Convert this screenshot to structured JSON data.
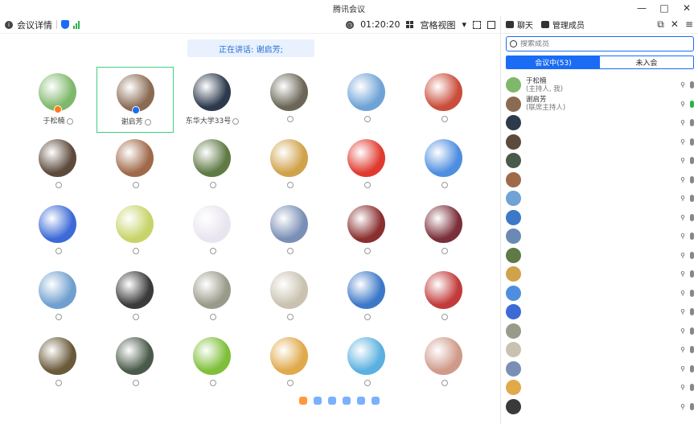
{
  "window": {
    "title": "腾讯会议",
    "controls": [
      "—",
      "□",
      "✕"
    ]
  },
  "toolbar": {
    "meeting_details": "会议详情",
    "timer": "01:20:20",
    "view_mode": "宫格视图"
  },
  "speaker_banner": "正在讲话: 谢启芳;",
  "grid": {
    "tiles": [
      {
        "name": "于松楠",
        "color": "#7fb86b",
        "badge": "orange"
      },
      {
        "name": "谢启芳",
        "color": "#8a6b52",
        "badge": "blue",
        "active": true
      },
      {
        "name": "东华大学33号",
        "color": "#2d3a4d",
        "badge": ""
      },
      {
        "name": "",
        "color": "#6b6657",
        "badge": ""
      },
      {
        "name": "",
        "color": "#6fa3d6",
        "badge": ""
      },
      {
        "name": "",
        "color": "#c94d3a",
        "badge": ""
      },
      {
        "name": "",
        "color": "#5c4a3c",
        "badge": ""
      },
      {
        "name": "",
        "color": "#a06a4a",
        "badge": ""
      },
      {
        "name": "",
        "color": "#5f7a44",
        "badge": ""
      },
      {
        "name": "",
        "color": "#d0a24a",
        "badge": ""
      },
      {
        "name": "",
        "color": "#e03a2f",
        "badge": ""
      },
      {
        "name": "",
        "color": "#4e8ee0",
        "badge": ""
      },
      {
        "name": "",
        "color": "#3c6ad6",
        "badge": ""
      },
      {
        "name": "",
        "color": "#c8d46a",
        "badge": ""
      },
      {
        "name": "",
        "color": "#e9e5f0",
        "badge": ""
      },
      {
        "name": "",
        "color": "#7a8fb5",
        "badge": ""
      },
      {
        "name": "",
        "color": "#8a2f2f",
        "badge": ""
      },
      {
        "name": "",
        "color": "#7a2f3a",
        "badge": ""
      },
      {
        "name": "",
        "color": "#6f9fcf",
        "badge": ""
      },
      {
        "name": "",
        "color": "#3a3a3a",
        "badge": ""
      },
      {
        "name": "",
        "color": "#9a9a8a",
        "badge": ""
      },
      {
        "name": "",
        "color": "#c9c2b0",
        "badge": ""
      },
      {
        "name": "",
        "color": "#3c78c8",
        "badge": ""
      },
      {
        "name": "",
        "color": "#c23a3a",
        "badge": ""
      },
      {
        "name": "",
        "color": "#6a5a3a",
        "badge": ""
      },
      {
        "name": "",
        "color": "#4a5a4a",
        "badge": ""
      },
      {
        "name": "",
        "color": "#7fbf3a",
        "badge": ""
      },
      {
        "name": "",
        "color": "#e0a94a",
        "badge": ""
      },
      {
        "name": "",
        "color": "#5ab0e0",
        "badge": ""
      },
      {
        "name": "",
        "color": "#d09a8a",
        "badge": ""
      }
    ]
  },
  "panel": {
    "tab_chat": "聊天",
    "tab_members": "管理成员",
    "search_placeholder": "搜索成员",
    "seg_in_meeting": "会议中(53)",
    "seg_not_joined": "未入会",
    "members": [
      {
        "name": "于松楠",
        "sub": "(主持人, 我)",
        "color": "#7fb86b",
        "mic": "gray"
      },
      {
        "name": "谢启芳",
        "sub": "(联席主持人)",
        "color": "#8a6b52",
        "mic": "green"
      },
      {
        "name": "",
        "sub": "",
        "color": "#2d3a4d",
        "mic": "gray"
      },
      {
        "name": "",
        "sub": "",
        "color": "#5c4a3c",
        "mic": "gray"
      },
      {
        "name": "",
        "sub": "",
        "color": "#4a5a4a",
        "mic": "gray"
      },
      {
        "name": "",
        "sub": "",
        "color": "#a06a4a",
        "mic": "gray"
      },
      {
        "name": "",
        "sub": "",
        "color": "#6fa3d6",
        "mic": "gray"
      },
      {
        "name": "",
        "sub": "",
        "color": "#3c78c8",
        "mic": "gray"
      },
      {
        "name": "",
        "sub": "",
        "color": "#6a8ab5",
        "mic": "gray"
      },
      {
        "name": "",
        "sub": "",
        "color": "#5f7a44",
        "mic": "gray"
      },
      {
        "name": "",
        "sub": "",
        "color": "#d0a24a",
        "mic": "gray"
      },
      {
        "name": "",
        "sub": "",
        "color": "#4e8ee0",
        "mic": "gray"
      },
      {
        "name": "",
        "sub": "",
        "color": "#3c6ad6",
        "mic": "gray"
      },
      {
        "name": "",
        "sub": "",
        "color": "#9a9a8a",
        "mic": "gray"
      },
      {
        "name": "",
        "sub": "",
        "color": "#c9c2b0",
        "mic": "gray"
      },
      {
        "name": "",
        "sub": "",
        "color": "#7a8fb5",
        "mic": "gray"
      },
      {
        "name": "",
        "sub": "",
        "color": "#e0a94a",
        "mic": "gray"
      },
      {
        "name": "",
        "sub": "",
        "color": "#3a3a3a",
        "mic": "gray"
      }
    ]
  }
}
